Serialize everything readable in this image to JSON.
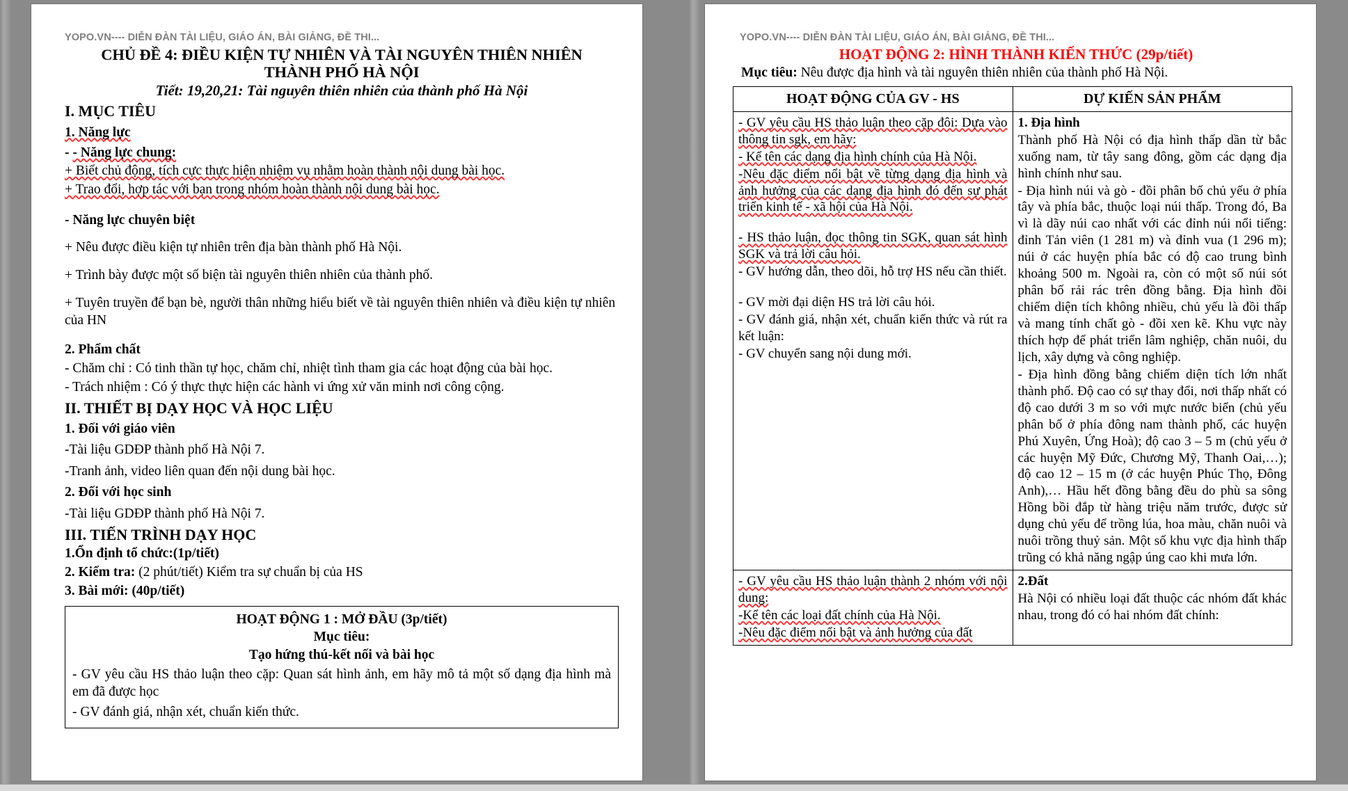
{
  "watermark": "YOPO.VN---- DIỄN ĐÀN TÀI LIỆU, GIÁO ÁN, BÀI GIẢNG, ĐỀ THI...",
  "colors": {
    "accent_red": "#ff0000",
    "watermark_gray": "#7f7f7f",
    "spellcheck": "#ff2b2b"
  },
  "left_page": {
    "title_line1": "CHỦ ĐỀ 4: ĐIỀU KIỆN TỰ NHIÊN VÀ TÀI NGUYÊN THIÊN NHIÊN",
    "title_line2": "THÀNH PHỐ HÀ NỘI",
    "subtitle": "Tiết: 19,20,21: Tài nguyên thiên nhiên của thành phố Hà Nội",
    "s1_heading": "I. MỤC TIÊU",
    "s1_1": "1. Năng lực",
    "s1_1_a": "- Năng lực chung:",
    "s1_1_a1": "+ Biết chủ động, tích cực thực hiện nhiệm vụ nhằm hoàn thành nội dung bài học.",
    "s1_1_a2": "+ Trao đổi, hợp tác với bạn trong nhóm hoàn thành nội dung bài học.",
    "s1_1_b": "- Năng lực chuyên biệt",
    "s1_1_b1": "+ Nêu được điều kiện tự nhiên trên địa bàn thành phố Hà Nội.",
    "s1_1_b2": "+ Trình bày được một số biện tài nguyên thiên nhiên của thành phố.",
    "s1_1_b3": "+ Tuyên truyền để bạn bè, người thân những hiểu biết về tài nguyên thiên nhiên và điều kiện tự nhiên của HN",
    "s1_2": "2. Phẩm chất",
    "s1_2_a": "- Chăm chỉ : Có tinh thần tự học, chăm chỉ, nhiệt tình tham gia các hoạt động của bài học.",
    "s1_2_b": "- Trách nhiệm : Có ý thực thực hiện các hành vi ứng xử văn minh nơi công cộng.",
    "s2_heading": "II. THIẾT BỊ DẠY HỌC VÀ HỌC LIỆU",
    "s2_1": "1. Đối với giáo viên",
    "s2_1_a": "-Tài liệu GDĐP thành phố Hà Nội 7.",
    "s2_1_b": "-Tranh ảnh, video liên quan đến nội dung bài học.",
    "s2_2": "2. Đối với học sinh",
    "s2_2_a": "-Tài liệu GDĐP thành phố Hà Nội 7.",
    "s3_heading": "III. TIẾN TRÌNH DẠY HỌC",
    "s3_1": "1.Ổn định tổ chức:(1p/tiết)",
    "s3_2_label": "2. Kiểm tra:",
    "s3_2_rest": " (2 phút/tiết) Kiểm tra sự chuẩn bị của HS",
    "s3_3": "3. Bài mới:  (40p/tiết)",
    "activity1": {
      "title": "HOẠT ĐỘNG 1 : MỞ ĐẦU (3p/tiết)",
      "goal_label": "Mục tiêu:",
      "goal_text": "Tạo hứng thú-kết nối và bài học",
      "line1": "- GV yêu cầu HS thảo luận theo cặp: Quan sát hình ảnh, em hãy mô tả một số dạng địa hình mà em đã được học",
      "line2": "- GV đánh giá, nhận xét, chuẩn kiến thức."
    }
  },
  "right_page": {
    "activity2_title": "HOẠT ĐỘNG 2: HÌNH THÀNH KIẾN THỨC (29p/tiết)",
    "goal_label": "Mục tiêu:",
    "goal_text": " Nêu được địa hình và tài nguyên thiên nhiên của thành phố Hà Nội.",
    "table": {
      "headers": [
        "HOẠT ĐỘNG CỦA GV - HS",
        "DỰ KIẾN SẢN PHẨM"
      ],
      "row1": {
        "col_a": [
          "- GV yêu cầu HS thảo luận theo cặp đôi: Dựa vào thông tin sgk, em hãy:",
          "- Kể tên các dạng địa hình chính của Hà Nội.",
          "-Nêu đặc điểm nổi bật về từng dạng địa hình và ảnh hưởng của các dạng địa hình đó đến sự phát triển kinh tế - xã hội của Hà Nội.",
          "",
          "- HS thảo luận, đọc thông tin SGK, quan sát hình SGK và trả lời câu hỏi.",
          "-  GV hướng dẫn, theo dõi, hỗ trợ HS nếu cần thiết.",
          "",
          "- GV mời đại diện HS trả lời câu hỏi.",
          "-  GV đánh giá, nhận xét, chuẩn kiến thức và rút ra kết luận:",
          "- GV chuyển sang nội dung mới."
        ],
        "col_b_heading": "1. Địa hình",
        "col_b": [
          "Thành phố Hà Nội có địa hình thấp dần từ bắc xuống nam, từ tây sang đông, gồm các dạng địa hình chính như sau.",
          "- Địa hình núi và gò - đồi phân bố chủ yếu ở phía tây và phía bắc, thuộc loại núi thấp. Trong đó, Ba vì là dãy núi cao nhất với các đỉnh núi nổi tiếng: đỉnh Tản viên (1 281 m) và đỉnh vua (1 296 m); núi ở các huyện phía bắc có độ cao trung bình khoảng 500 m. Ngoài ra, còn có một số núi sót phân bố rải rác trên đồng bằng. Địa hình đồi chiếm diện tích không nhiều, chủ yếu là đồi thấp và mang tính chất gò - đồi xen kẽ. Khu vực này thích hợp để phát triển lâm nghiệp, chăn nuôi, du lịch, xây dựng và công nghiệp.",
          "- Địa hình đồng bằng chiếm diện tích lớn nhất thành phố. Độ cao có sự thay đổi, nơi thấp nhất có độ cao dưới 3 m so với mực nước biển (chủ yếu phân bố ở phía đông nam thành phố, các huyện Phú Xuyên, Ứng Hoà); độ cao 3 – 5 m (chủ yếu ở các huyện Mỹ Đức, Chương Mỹ, Thanh Oai,…); độ cao 12 – 15 m (ở các huyện Phúc Thọ, Đông Anh),… Hầu hết đồng bằng đều do phù sa sông Hồng bồi đắp từ hàng triệu năm trước, được sử dụng chủ yếu để trồng lúa, hoa màu, chăn nuôi và nuôi trồng thuỷ sản. Một số khu vực địa hình thấp trũng có khả năng ngập úng cao khi mưa lớn."
        ]
      },
      "row2": {
        "col_a": [
          "- GV yêu cầu HS thảo luận thành 2 nhóm với nội dung:",
          "-Kể tên các loại đất chính của Hà Nội.",
          "-Nêu đặc điểm nổi bật và ảnh hưởng của đất"
        ],
        "col_b_heading": "2.Đất",
        "col_b": [
          "Hà Nội có nhiều loại đất thuộc các nhóm đất khác nhau, trong đó có hai nhóm đất chính:"
        ]
      }
    }
  }
}
